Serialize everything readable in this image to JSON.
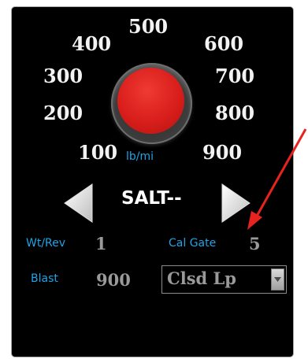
{
  "dial": {
    "values": [
      "100",
      "200",
      "300",
      "400",
      "500",
      "600",
      "700",
      "800",
      "900"
    ],
    "unit": "lb/mi",
    "knob_color": "#d91e1b"
  },
  "mode": {
    "label": "SALT--",
    "prev_icon": "triangle-left-icon",
    "next_icon": "triangle-right-icon"
  },
  "fields": {
    "wt_rev_label": "Wt/Rev",
    "wt_rev_value": "1",
    "cal_gate_label": "Cal Gate",
    "cal_gate_value": "5",
    "blast_label": "Blast",
    "blast_value": "900"
  },
  "loop_select": {
    "selected": "Clsd Lp"
  },
  "annotation": {
    "arrow_color": "#e8231f"
  },
  "colors": {
    "panel_bg": "#000000",
    "label_blue": "#1fa3e6",
    "value_gray": "#9a9a9a"
  }
}
